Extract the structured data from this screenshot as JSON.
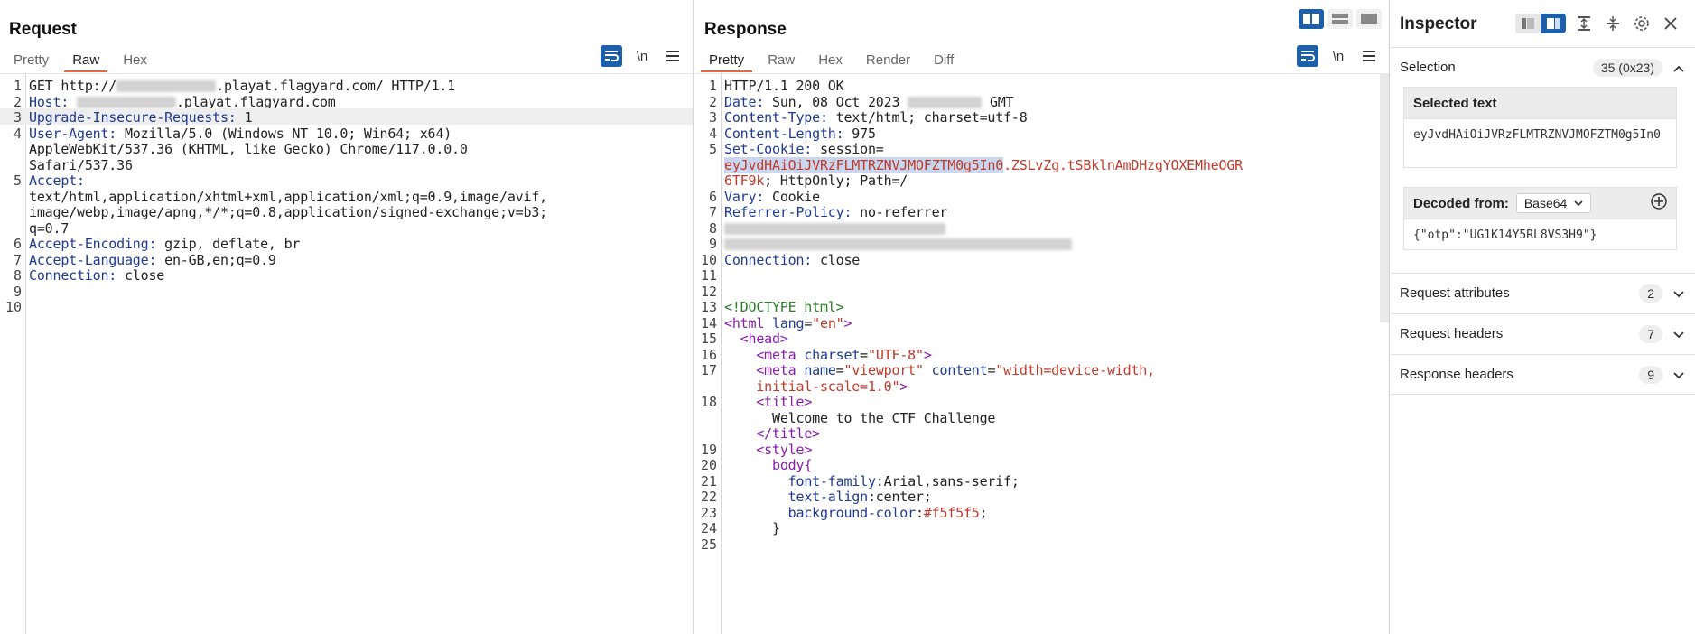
{
  "request": {
    "title": "Request",
    "tabs": [
      "Pretty",
      "Raw",
      "Hex"
    ],
    "active_tab": "Raw",
    "lines": [
      {
        "n": "1",
        "parts": [
          {
            "t": "GET http://"
          },
          {
            "blur": 110
          },
          {
            "t": ".playat.flagyard.com/ HTTP/1.1"
          }
        ]
      },
      {
        "n": "2",
        "parts": [
          {
            "t": "Host:",
            "c": "key"
          },
          {
            "t": " "
          },
          {
            "blur": 110
          },
          {
            "t": ".playat.flagyard.com"
          }
        ]
      },
      {
        "n": "3",
        "hl": true,
        "parts": [
          {
            "t": "Upgrade-Insecure-Requests:",
            "c": "key"
          },
          {
            "t": " 1"
          }
        ]
      },
      {
        "n": "4",
        "parts": [
          {
            "t": "User-Agent:",
            "c": "key"
          },
          {
            "t": " Mozilla/5.0 (Windows NT 10.0; Win64; x64)"
          }
        ]
      },
      {
        "n": "",
        "parts": [
          {
            "t": "AppleWebKit/537.36 (KHTML, like Gecko) Chrome/117.0.0.0"
          }
        ]
      },
      {
        "n": "",
        "parts": [
          {
            "t": "Safari/537.36"
          }
        ]
      },
      {
        "n": "5",
        "parts": [
          {
            "t": "Accept:",
            "c": "key"
          }
        ]
      },
      {
        "n": "",
        "parts": [
          {
            "t": "text/html,application/xhtml+xml,application/xml;q=0.9,image/avif,"
          }
        ]
      },
      {
        "n": "",
        "parts": [
          {
            "t": "image/webp,image/apng,*/*;q=0.8,application/signed-exchange;v=b3;"
          }
        ]
      },
      {
        "n": "",
        "parts": [
          {
            "t": "q=0.7"
          }
        ]
      },
      {
        "n": "6",
        "parts": [
          {
            "t": "Accept-Encoding:",
            "c": "key"
          },
          {
            "t": " gzip, deflate, br"
          }
        ]
      },
      {
        "n": "7",
        "parts": [
          {
            "t": "Accept-Language:",
            "c": "key"
          },
          {
            "t": " en-GB,en;q=0.9"
          }
        ]
      },
      {
        "n": "8",
        "parts": [
          {
            "t": "Connection:",
            "c": "key"
          },
          {
            "t": " close"
          }
        ]
      },
      {
        "n": "9",
        "parts": []
      },
      {
        "n": "10",
        "parts": []
      }
    ]
  },
  "response": {
    "title": "Response",
    "tabs": [
      "Pretty",
      "Raw",
      "Hex",
      "Render",
      "Diff"
    ],
    "active_tab": "Pretty",
    "lines": [
      {
        "n": "1",
        "parts": [
          {
            "t": "HTTP/1.1 200 OK"
          }
        ]
      },
      {
        "n": "2",
        "parts": [
          {
            "t": "Date:",
            "c": "key"
          },
          {
            "t": " Sun, 08 Oct 2023 "
          },
          {
            "blur": 82
          },
          {
            "t": " GMT"
          }
        ]
      },
      {
        "n": "3",
        "parts": [
          {
            "t": "Content-Type:",
            "c": "key"
          },
          {
            "t": " text/html; charset=utf-8"
          }
        ]
      },
      {
        "n": "4",
        "parts": [
          {
            "t": "Content-Length:",
            "c": "key"
          },
          {
            "t": " 975"
          }
        ]
      },
      {
        "n": "5",
        "parts": [
          {
            "t": "Set-Cookie:",
            "c": "key"
          },
          {
            "t": " session="
          }
        ]
      },
      {
        "n": "",
        "parts": [
          {
            "t": "eyJvdHAiOiJVRzFLMTRZNVJMOFZTM0g5In0",
            "c": "str sel"
          },
          {
            "t": ".ZSLvZg.tSBklnAmDHzgYOXEMheOGR",
            "c": "str"
          }
        ]
      },
      {
        "n": "",
        "parts": [
          {
            "t": "6TF9k",
            "c": "str"
          },
          {
            "t": "; HttpOnly; Path=/"
          }
        ]
      },
      {
        "n": "6",
        "parts": [
          {
            "t": "Vary:",
            "c": "key"
          },
          {
            "t": " Cookie"
          }
        ]
      },
      {
        "n": "7",
        "parts": [
          {
            "t": "Referrer-Policy:",
            "c": "key"
          },
          {
            "t": " no-referrer"
          }
        ]
      },
      {
        "n": "8",
        "parts": [
          {
            "blur": 245
          }
        ]
      },
      {
        "n": "9",
        "parts": [
          {
            "blur": 385
          }
        ]
      },
      {
        "n": "10",
        "parts": [
          {
            "t": "Connection:",
            "c": "key"
          },
          {
            "t": " close"
          }
        ]
      },
      {
        "n": "11",
        "parts": []
      },
      {
        "n": "12",
        "parts": []
      },
      {
        "n": "13",
        "parts": [
          {
            "t": "<!DOCTYPE html>",
            "c": "doc"
          }
        ]
      },
      {
        "n": "14",
        "parts": [
          {
            "t": "<html ",
            "c": "tag"
          },
          {
            "t": "lang",
            "c": "attr"
          },
          {
            "t": "="
          },
          {
            "t": "\"en\"",
            "c": "str"
          },
          {
            "t": ">",
            "c": "tag"
          }
        ]
      },
      {
        "n": "15",
        "parts": [
          {
            "t": "  "
          },
          {
            "t": "<head>",
            "c": "tag"
          }
        ]
      },
      {
        "n": "16",
        "parts": [
          {
            "t": "    "
          },
          {
            "t": "<meta ",
            "c": "tag"
          },
          {
            "t": "charset",
            "c": "attr"
          },
          {
            "t": "="
          },
          {
            "t": "\"UTF-8\"",
            "c": "str"
          },
          {
            "t": ">",
            "c": "tag"
          }
        ]
      },
      {
        "n": "17",
        "parts": [
          {
            "t": "    "
          },
          {
            "t": "<meta ",
            "c": "tag"
          },
          {
            "t": "name",
            "c": "attr"
          },
          {
            "t": "="
          },
          {
            "t": "\"viewport\"",
            "c": "str"
          },
          {
            "t": " "
          },
          {
            "t": "content",
            "c": "attr"
          },
          {
            "t": "="
          },
          {
            "t": "\"width=device-width,",
            "c": "str"
          }
        ]
      },
      {
        "n": "",
        "parts": [
          {
            "t": "    "
          },
          {
            "t": "initial-scale=1.0\"",
            "c": "str"
          },
          {
            "t": ">",
            "c": "tag"
          }
        ]
      },
      {
        "n": "18",
        "parts": [
          {
            "t": "    "
          },
          {
            "t": "<title>",
            "c": "tag"
          }
        ]
      },
      {
        "n": "",
        "parts": [
          {
            "t": "      Welcome to the CTF Challenge"
          }
        ]
      },
      {
        "n": "",
        "parts": [
          {
            "t": "    "
          },
          {
            "t": "</title>",
            "c": "tag"
          }
        ]
      },
      {
        "n": "19",
        "parts": [
          {
            "t": "    "
          },
          {
            "t": "<style>",
            "c": "tag"
          }
        ]
      },
      {
        "n": "20",
        "parts": [
          {
            "t": "      "
          },
          {
            "t": "body{",
            "c": "tag"
          }
        ]
      },
      {
        "n": "21",
        "parts": [
          {
            "t": "        "
          },
          {
            "t": "font-family",
            "c": "attr"
          },
          {
            "t": ":Arial,sans-serif;"
          }
        ]
      },
      {
        "n": "22",
        "parts": [
          {
            "t": "        "
          },
          {
            "t": "text-align",
            "c": "attr"
          },
          {
            "t": ":center;"
          }
        ]
      },
      {
        "n": "23",
        "parts": [
          {
            "t": "        "
          },
          {
            "t": "background-color",
            "c": "attr"
          },
          {
            "t": ":"
          },
          {
            "t": "#f5f5f5",
            "c": "str"
          },
          {
            "t": ";"
          }
        ]
      },
      {
        "n": "24",
        "parts": [
          {
            "t": "      }"
          }
        ]
      },
      {
        "n": "25",
        "parts": []
      }
    ]
  },
  "inspector": {
    "title": "Inspector",
    "selection_label": "Selection",
    "selection_count": "35 (0x23)",
    "selected_text_label": "Selected text",
    "selected_text": "eyJvdHAiOiJVRzFLMTRZNVJMOFZTM0g5In0",
    "decoded_label": "Decoded from:",
    "decoded_format": "Base64",
    "decoded_value": "{\"otp\":\"UG1K14Y5RL8VS3H9\"}",
    "sections": [
      {
        "label": "Request attributes",
        "count": "2"
      },
      {
        "label": "Request headers",
        "count": "7"
      },
      {
        "label": "Response headers",
        "count": "9"
      }
    ]
  },
  "icons": {
    "wrap": "wrap-icon",
    "newline": "\\n",
    "menu": "hamburger-icon"
  },
  "colors": {
    "accent": "#1d5fa8",
    "active_tab_underline": "#e8683f",
    "header_key": "#1f3a93",
    "string": "#c0392b",
    "tag": "#8a1cad"
  }
}
